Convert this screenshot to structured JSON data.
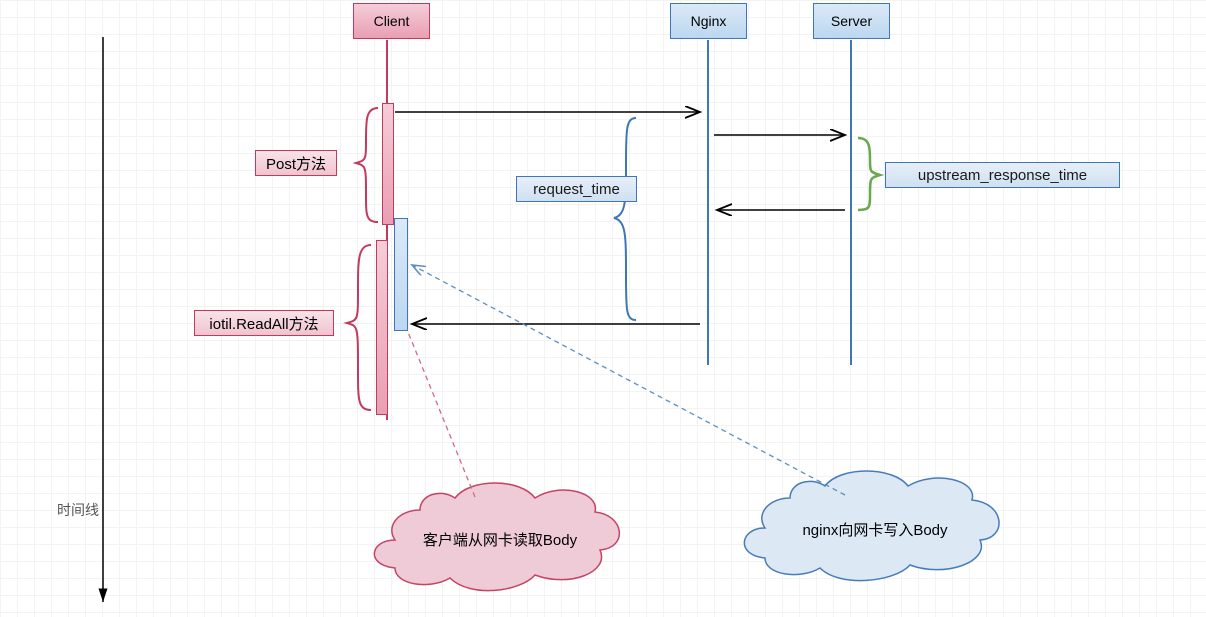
{
  "participants": {
    "client": "Client",
    "nginx": "Nginx",
    "server": "Server"
  },
  "labels": {
    "post_method": "Post方法",
    "request_time": "request_time",
    "upstream_response_time": "upstream_response_time",
    "iotil_readall": "iotil.ReadAll方法"
  },
  "clouds": {
    "client_read_body": "客户端从网卡读取Body",
    "nginx_write_body": "nginx向网卡写入Body"
  },
  "axis": {
    "timeline": "时间线"
  }
}
